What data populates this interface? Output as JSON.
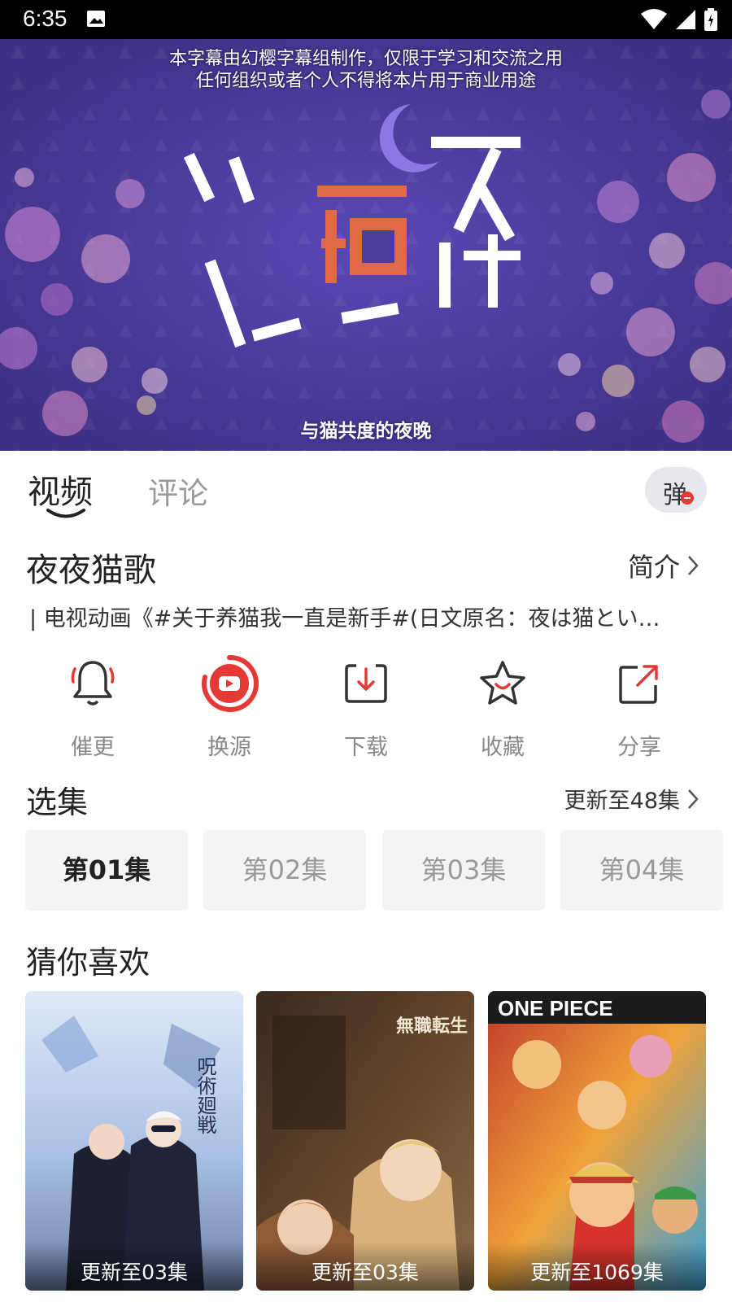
{
  "status_bar": {
    "time": "6:35"
  },
  "banner": {
    "subtitle_line1": "本字幕由幻樱字幕组制作，仅限于学习和交流之用",
    "subtitle_line2": "任何组织或者个人不得将本片用于商业用途",
    "logo_text": "夜は猫といっしょ",
    "tagline": "与猫共度的夜晚"
  },
  "tabs": [
    {
      "label": "视频",
      "active": true
    },
    {
      "label": "评论",
      "active": false
    }
  ],
  "danmaku_button": {
    "label": "弹"
  },
  "show": {
    "title": "夜夜猫歌",
    "intro_label": "简介",
    "description": "| 电视动画《#关于养猫我一直是新手#(日文原名：夜は猫とい…"
  },
  "actions": [
    {
      "label": "催更",
      "icon": "bell-icon"
    },
    {
      "label": "换源",
      "icon": "play-source-icon"
    },
    {
      "label": "下载",
      "icon": "download-icon"
    },
    {
      "label": "收藏",
      "icon": "star-icon"
    },
    {
      "label": "分享",
      "icon": "share-icon"
    }
  ],
  "episodes": {
    "title": "选集",
    "update_label": "更新至48集",
    "items": [
      {
        "label": "第01集",
        "selected": true
      },
      {
        "label": "第02集",
        "selected": false
      },
      {
        "label": "第03集",
        "selected": false
      },
      {
        "label": "第04集",
        "selected": false
      }
    ]
  },
  "recommend": {
    "title": "猜你喜欢",
    "items": [
      {
        "badge": "更新至03集",
        "poster_text": "呪術廻戦"
      },
      {
        "badge": "更新至03集",
        "poster_text": "無職転生"
      },
      {
        "badge": "更新至1069集",
        "poster_text": "ONE PIECE"
      }
    ]
  },
  "colors": {
    "accent": "#e53935",
    "banner_bg": "#4b3d9a",
    "muted_text": "#888888"
  }
}
